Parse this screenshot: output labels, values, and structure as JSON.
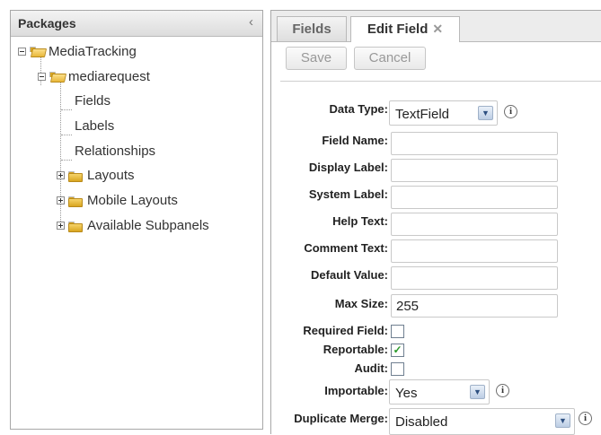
{
  "packages_panel": {
    "title": "Packages",
    "collapse_glyph": "‹",
    "tree": {
      "root": "MediaTracking",
      "module": "mediarequest",
      "leaves": [
        "Fields",
        "Labels",
        "Relationships"
      ],
      "folders": [
        "Layouts",
        "Mobile Layouts",
        "Available Subpanels"
      ]
    }
  },
  "tabs": [
    {
      "label": "Fields",
      "active": false
    },
    {
      "label": "Edit Field",
      "active": true,
      "close_glyph": "✕"
    }
  ],
  "toolbar": {
    "save_label": "Save",
    "cancel_label": "Cancel"
  },
  "form": {
    "data_type": {
      "label": "Data Type:",
      "value": "TextField"
    },
    "field_name": {
      "label": "Field Name:",
      "value": ""
    },
    "display_label": {
      "label": "Display Label:",
      "value": ""
    },
    "system_label": {
      "label": "System Label:",
      "value": ""
    },
    "help_text": {
      "label": "Help Text:",
      "value": ""
    },
    "comment_text": {
      "label": "Comment Text:",
      "value": ""
    },
    "default_value": {
      "label": "Default Value:",
      "value": ""
    },
    "max_size": {
      "label": "Max Size:",
      "value": "255"
    },
    "required_field": {
      "label": "Required Field:",
      "checked": false
    },
    "reportable": {
      "label": "Reportable:",
      "checked": true
    },
    "audit": {
      "label": "Audit:",
      "checked": false
    },
    "importable": {
      "label": "Importable:",
      "value": "Yes"
    },
    "duplicate_merge": {
      "label": "Duplicate Merge:",
      "value": "Disabled"
    }
  },
  "icons": {
    "info": "info-icon",
    "dropdown": "chevron-down-icon",
    "folder": "folder-icon",
    "check_glyph": "✓",
    "info_glyph": "i",
    "arrow_glyph": "▼"
  },
  "colors": {
    "checkmark": "#2a9a2a",
    "folder": "#d9a520",
    "select_arrow": "#bccde4"
  }
}
